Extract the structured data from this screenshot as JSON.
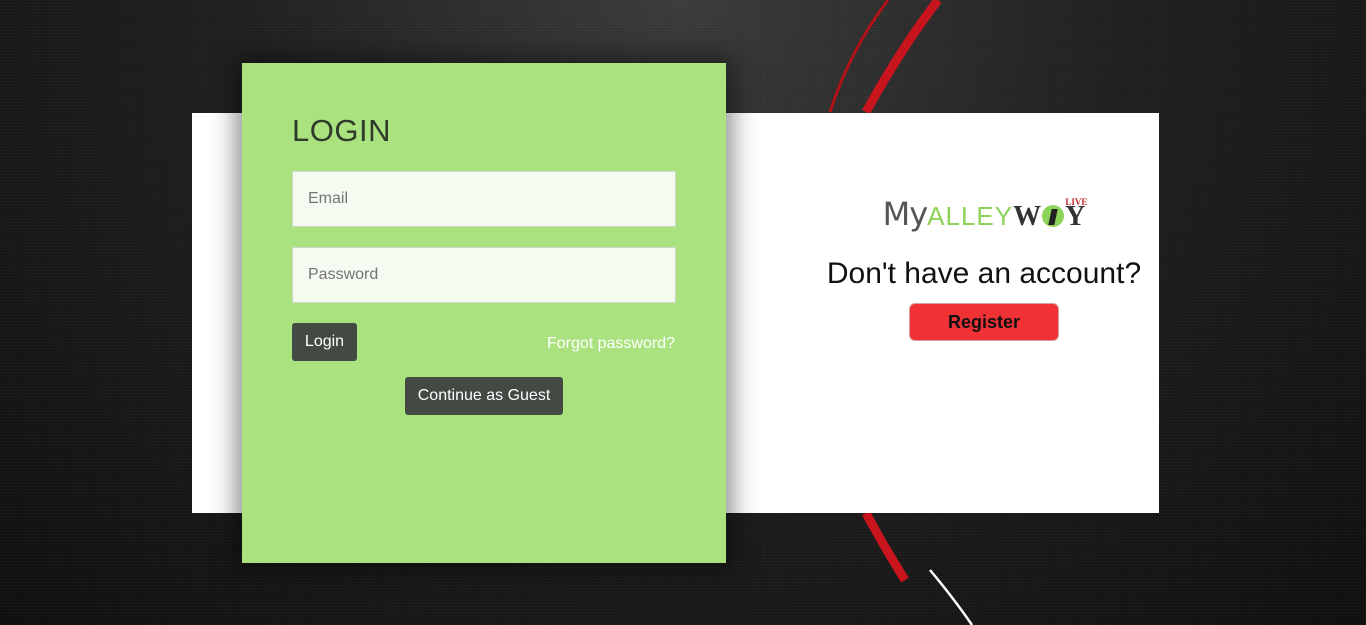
{
  "login": {
    "title": "LOGIN",
    "email_placeholder": "Email",
    "password_placeholder": "Password",
    "login_button": "Login",
    "forgot_link": "Forgot password?",
    "guest_button": "Continue as Guest"
  },
  "brand": {
    "my": "My",
    "alley": "ALLEY",
    "way_w": "W",
    "way_y": "Y",
    "live": "LIVE"
  },
  "signup": {
    "heading": "Don't have an account?",
    "register_button": "Register"
  },
  "colors": {
    "login_panel": "#aae27f",
    "dark_button": "#434a44",
    "register_button": "#f03236",
    "brand_green": "#8cd35a",
    "accent_red": "#c1272d"
  }
}
